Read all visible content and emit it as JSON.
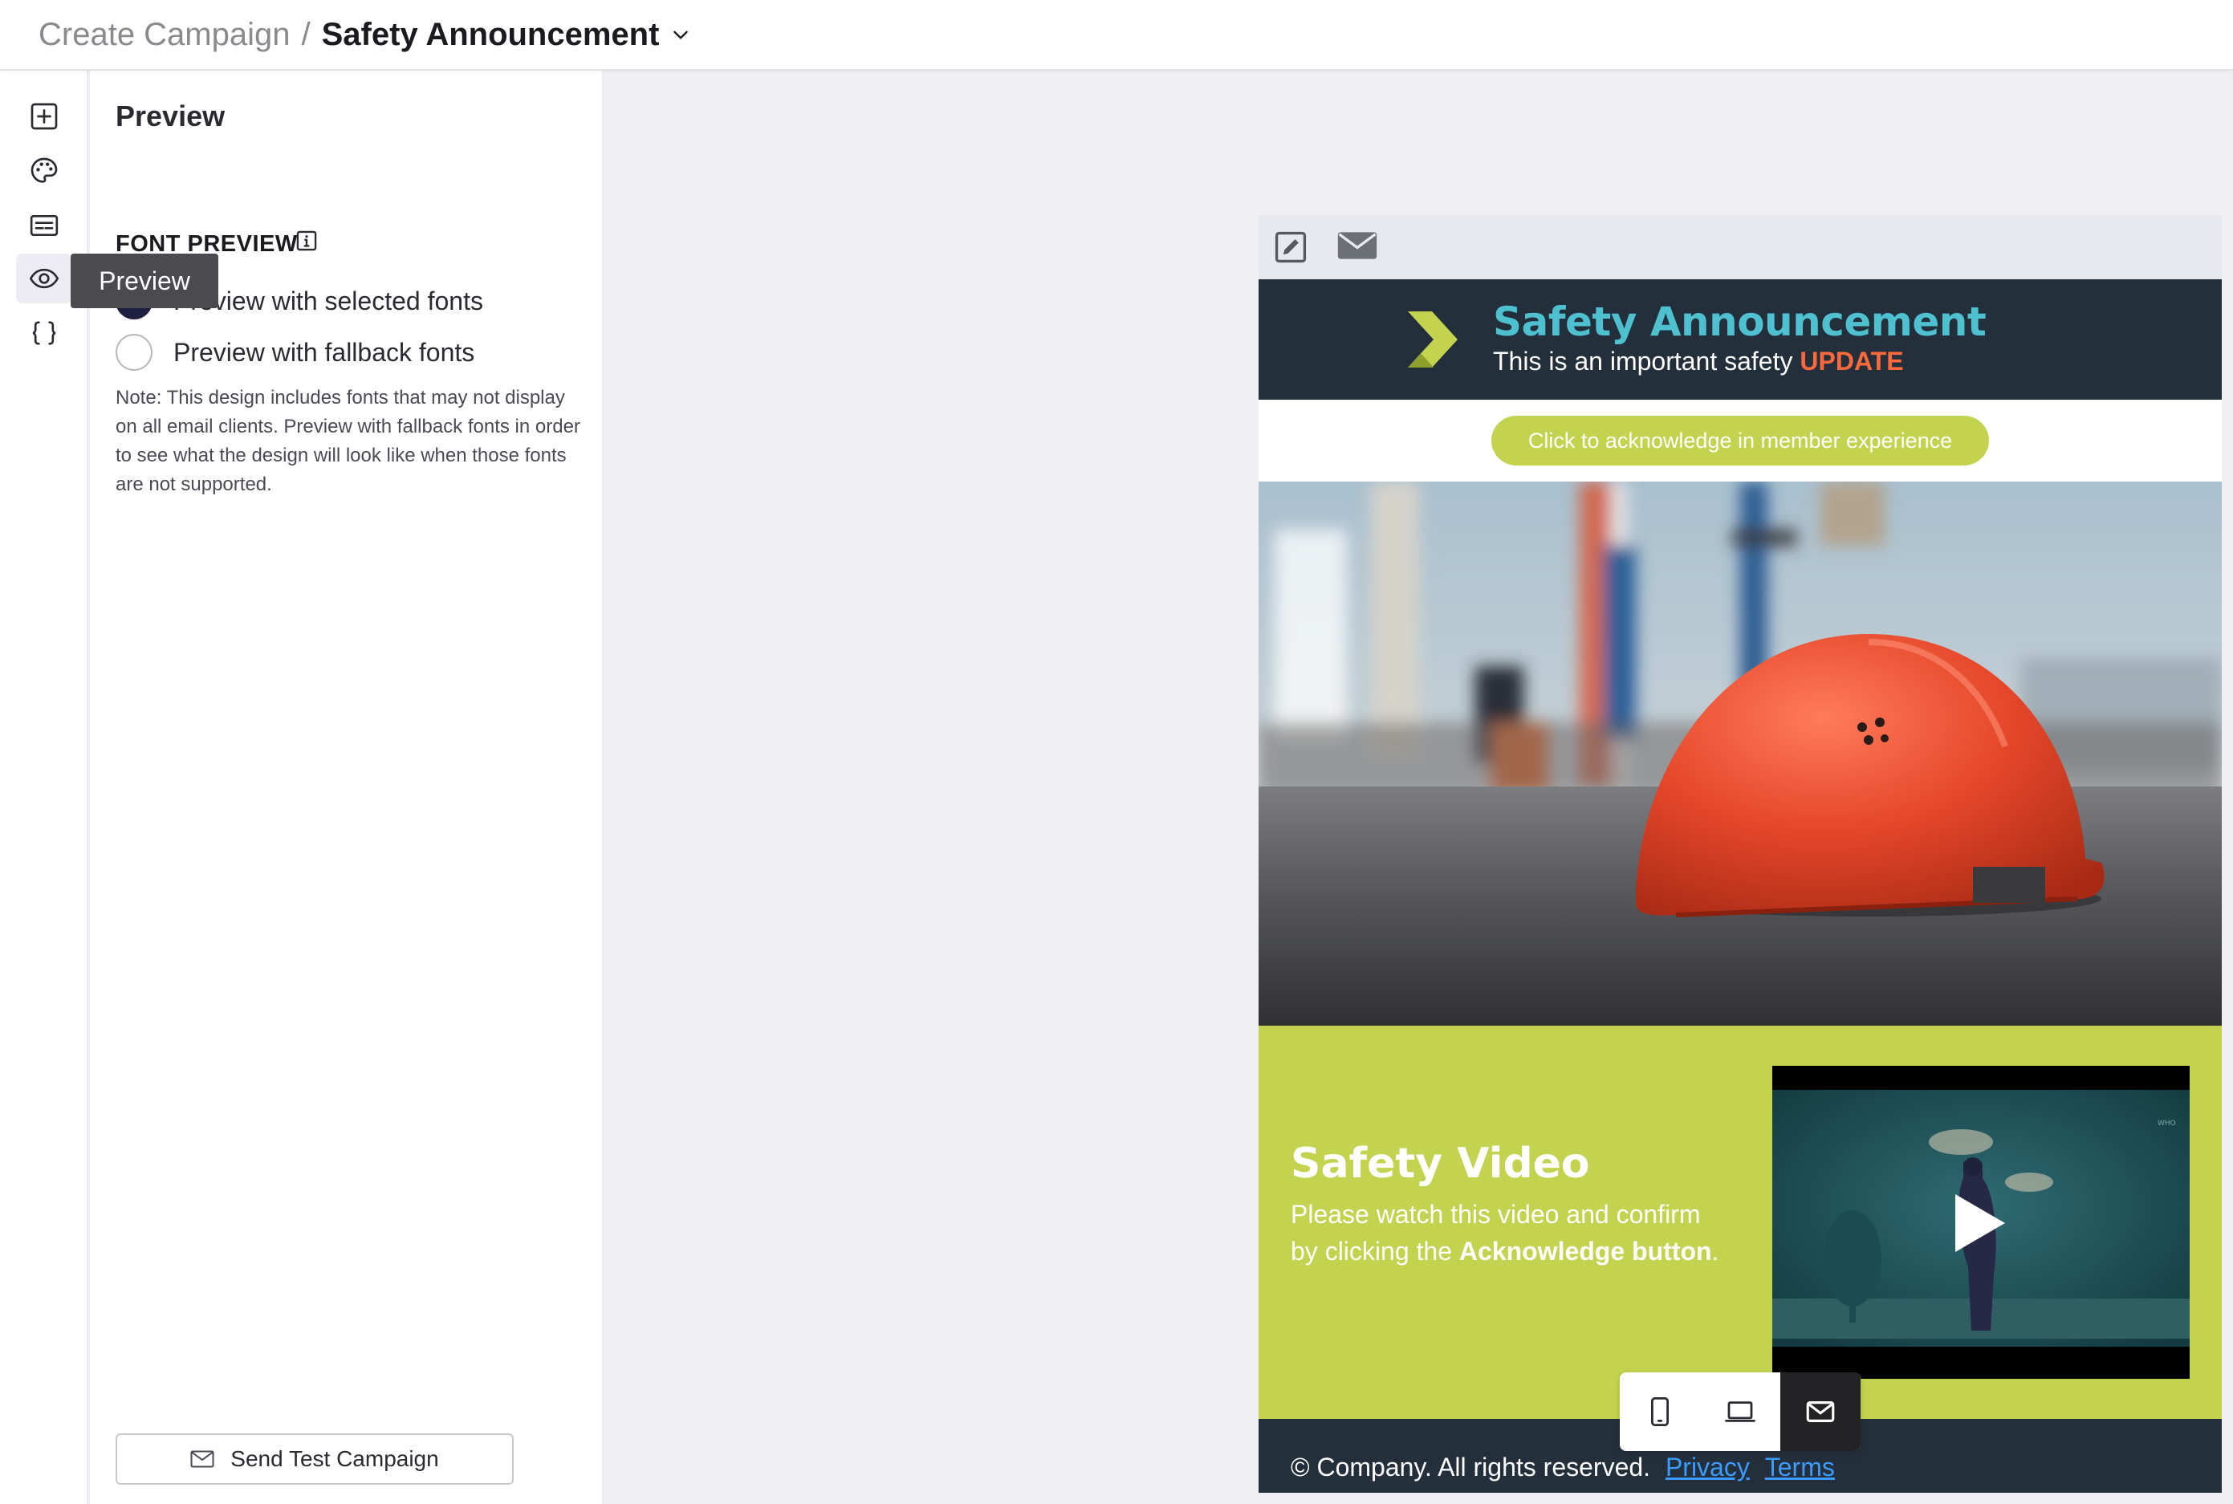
{
  "breadcrumb": {
    "parent": "Create Campaign",
    "separator": "/",
    "current": "Safety Announcement"
  },
  "rail": {
    "items": [
      {
        "icon": "add-block-icon"
      },
      {
        "icon": "palette-icon"
      },
      {
        "icon": "form-icon"
      },
      {
        "icon": "eye-icon"
      },
      {
        "icon": "code-braces-icon"
      }
    ],
    "tooltip": "Preview"
  },
  "panel": {
    "title": "Preview",
    "font_preview_label": "FONT PREVIEW",
    "options": [
      {
        "label": "Preview with selected fonts",
        "checked": true
      },
      {
        "label": "Preview with fallback fonts",
        "checked": false
      }
    ],
    "note": "Note: This design includes fonts that may not display on all email clients. Preview with fallback fonts in order to see what the design will look like when those fonts are not supported.",
    "send_button": "Send Test Campaign"
  },
  "email": {
    "header_title": "Safety Announcement",
    "header_sub_prefix": "This is an important safety",
    "header_sub_highlight": "UPDATE",
    "ack_button": "Click to acknowledge in member experience",
    "video_title": "Safety Video",
    "video_text_1": "Please watch this video and confirm by clicking the",
    "video_text_bold": "Acknowledge button",
    "video_text_end": ".",
    "footer_text": "© Company. All rights reserved.",
    "footer_privacy": "Privacy",
    "footer_terms": "Terms"
  },
  "colors": {
    "accent_teal": "#4ec0cf",
    "accent_lime": "#c3d34f",
    "header_dark": "#232f3b",
    "update_orange": "#ff6a3d",
    "link_blue": "#3d9bff"
  },
  "device_switcher": [
    {
      "icon": "mobile-icon",
      "active": false
    },
    {
      "icon": "laptop-icon",
      "active": false
    },
    {
      "icon": "mail-icon",
      "active": true
    }
  ]
}
